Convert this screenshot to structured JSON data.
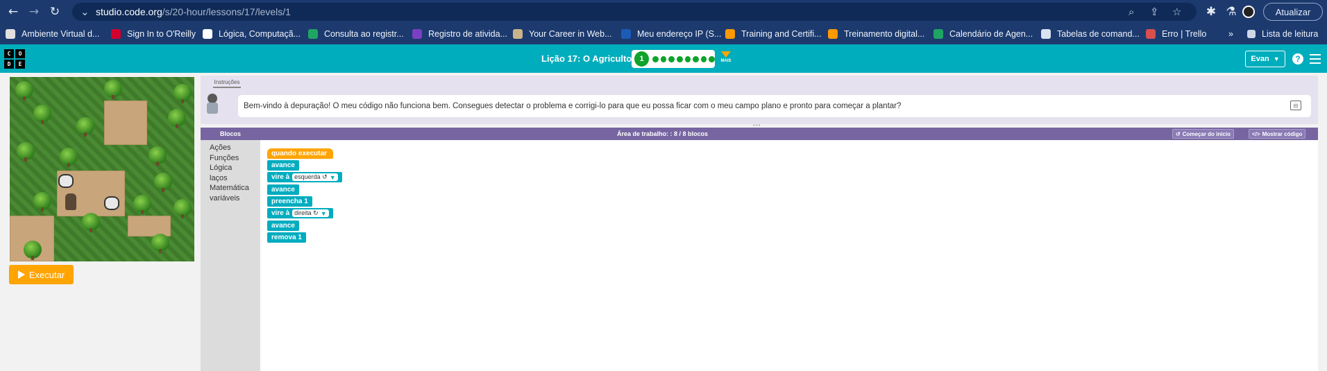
{
  "browser": {
    "url_host": "studio.code.org",
    "url_path": "/s/20-hour/lessons/17/levels/1",
    "update_label": "Atualizar",
    "bookmarks": [
      {
        "label": "Ambiente Virtual d...",
        "color": "#e0e0e0"
      },
      {
        "label": "Sign In to O'Reilly",
        "color": "#d3002d"
      },
      {
        "label": "Lógica, Computaçã...",
        "color": "#ffffff"
      },
      {
        "label": "Consulta ao registr...",
        "color": "#1fa463"
      },
      {
        "label": "Registro de ativida...",
        "color": "#7b3fc4"
      },
      {
        "label": "Your Career in Web...",
        "color": "#c9b48a"
      },
      {
        "label": "Meu endereço IP (S...",
        "color": "#1c5bb6"
      },
      {
        "label": "Training and Certifi...",
        "color": "#ff9900"
      },
      {
        "label": "Treinamento digital...",
        "color": "#ff9900"
      },
      {
        "label": "Calendário de Agen...",
        "color": "#1fa463"
      },
      {
        "label": "Tabelas de comand...",
        "color": "#d8e2f0"
      },
      {
        "label": "Erro | Trello",
        "color": "#d94f4f"
      }
    ],
    "more_bookmarks": "»",
    "reading_list": "Lista de leitura"
  },
  "header": {
    "logo_letters": [
      "C",
      "O",
      "D",
      "E"
    ],
    "lesson_title": "Lição 17: O Agricultor 3",
    "current_level": "1",
    "more_label": "MAIS",
    "user_name": "Evan",
    "help": "?"
  },
  "game": {
    "run_label": "Executar"
  },
  "instructions": {
    "tab_label": "Instruções",
    "text": "Bem-vindo à depuração! O meu código não funciona bem. Consegues detectar o problema e corrigi-lo para que eu possa ficar com o meu campo plano e pronto para começar a plantar?"
  },
  "workspace": {
    "toolbox_title": "Blocos",
    "area_label": "Área de trabalho: : 8 / 8 blocos",
    "start_over_label": "Começar do início",
    "show_code_label": "Mostrar código",
    "categories": [
      "Ações",
      "Funções",
      "Lógica",
      "laços",
      "Matemática",
      "variáveis"
    ],
    "blocks": {
      "when_run": "quando executar",
      "b1": "avance",
      "b2_label": "vire à",
      "b2_value": "esquerda ↺",
      "b3": "avance",
      "b4": "preencha 1",
      "b5_label": "vire à",
      "b5_value": "direita ↻",
      "b6": "avance",
      "b7": "remova 1"
    }
  }
}
